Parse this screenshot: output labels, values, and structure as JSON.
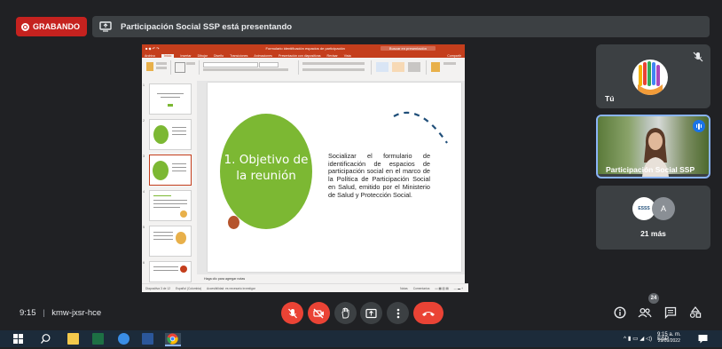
{
  "recording": {
    "label": "GRABANDO"
  },
  "presenting_banner": {
    "text": "Participación Social SSP está presentando"
  },
  "ppt": {
    "window_title": "Formulario identificación espacios de participación",
    "search_placeholder": "Buscar en presentación",
    "tabs": [
      "Archivo",
      "Inicio",
      "Insertar",
      "Dibujar",
      "Diseño",
      "Transiciones",
      "Animaciones",
      "Presentación con diapositivas",
      "Revisar",
      "Vista"
    ],
    "share_label": "Compartir",
    "notes_placeholder": "Haga clic para agregar notas",
    "status_left": "Diapositiva 3 de 12",
    "status_lang": "Español (Colombia)",
    "status_access": "Accesibilidad: es necesario investigar",
    "status_notes": "Notas",
    "status_comments": "Comentarios",
    "slide_numbers": [
      "1",
      "2",
      "3",
      "4",
      "5",
      "6"
    ]
  },
  "slide": {
    "title": "1. Objetivo de la reunión",
    "body": "Socializar el formulario de identificación de espacios de participación social en el marco de la Política de Participación Social en Salud, emitido por el Ministerio de Salud y Protección Social."
  },
  "participants": {
    "self_name": "Tú",
    "presenter_name": "Participación Social SSP",
    "others_initial": "A",
    "others_count": "21 más"
  },
  "bottom_bar": {
    "time": "9:15",
    "separator": "|",
    "meeting_code": "kmw-jxsr-hce",
    "people_count": "24"
  },
  "taskbar": {
    "language": "ESP",
    "time": "9:15 a. m.",
    "date": "29/09/2022"
  },
  "colors": {
    "slide_green": "#7cb833",
    "recording_red": "#c5221f",
    "ppt_orange": "#c43e1c",
    "hangup_red": "#ea4335",
    "meet_dark": "#202124"
  }
}
